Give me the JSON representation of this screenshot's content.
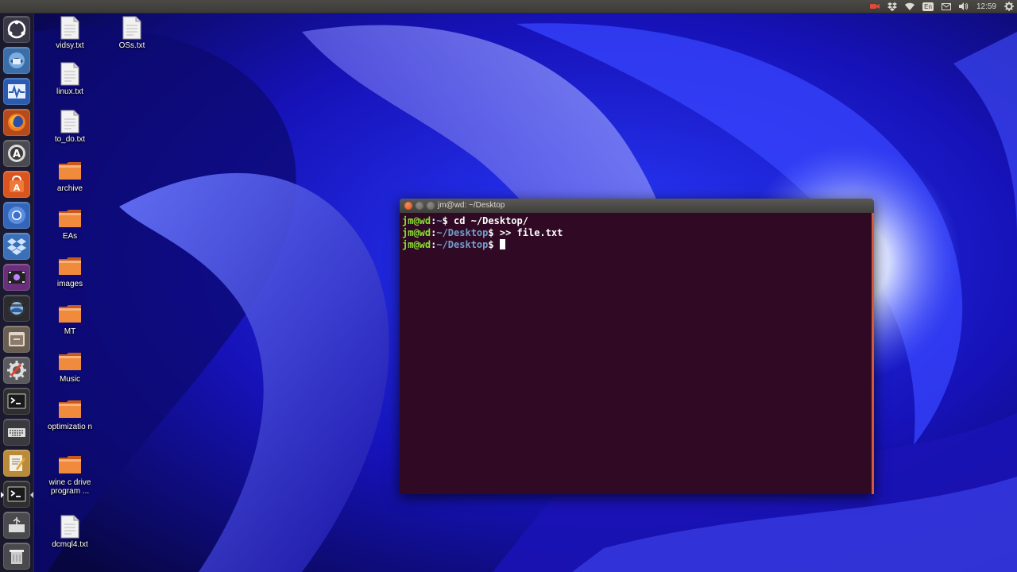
{
  "panel": {
    "clock": "12:59",
    "language": "En",
    "tray_icons": [
      "camera-icon",
      "dropbox-icon",
      "wifi-icon",
      "keyboard-layout-icon",
      "mail-icon",
      "volume-icon",
      "gear-icon"
    ]
  },
  "launcher": {
    "items": [
      {
        "name": "ubuntu-dash-icon"
      },
      {
        "name": "thunderbird-icon"
      },
      {
        "name": "system-monitor-icon"
      },
      {
        "name": "firefox-icon"
      },
      {
        "name": "software-updater-icon"
      },
      {
        "name": "ubuntu-software-center-icon"
      },
      {
        "name": "chromium-icon"
      },
      {
        "name": "dropbox-icon"
      },
      {
        "name": "video-editor-icon"
      },
      {
        "name": "photo-viewer-icon"
      },
      {
        "name": "files-icon"
      },
      {
        "name": "system-settings-icon"
      },
      {
        "name": "terminal-icon"
      },
      {
        "name": "keyboard-icon"
      },
      {
        "name": "text-editor-icon"
      },
      {
        "name": "terminal-active-icon"
      },
      {
        "name": "usb-drive-icon"
      },
      {
        "name": "trash-icon"
      }
    ]
  },
  "desktop": {
    "icons": [
      {
        "label": "vidsy.txt",
        "type": "text-file"
      },
      {
        "label": "OSs.txt",
        "type": "text-file"
      },
      {
        "label": "linux.txt",
        "type": "text-file"
      },
      {
        "label": "to_do.txt",
        "type": "text-file"
      },
      {
        "label": "archive",
        "type": "folder"
      },
      {
        "label": "EAs",
        "type": "folder"
      },
      {
        "label": "images",
        "type": "folder"
      },
      {
        "label": "MT",
        "type": "folder"
      },
      {
        "label": "Music",
        "type": "folder"
      },
      {
        "label": "optimizatio n",
        "type": "folder"
      },
      {
        "label": "wine c drive program ...",
        "type": "folder"
      },
      {
        "label": "dcmql4.txt",
        "type": "text-file"
      }
    ]
  },
  "terminal": {
    "title": "jm@wd: ~/Desktop",
    "lines": [
      {
        "user": "jm@wd",
        "sep": ":",
        "path": "~",
        "dollar": "$ ",
        "cmd": "cd ~/Desktop/"
      },
      {
        "user": "jm@wd",
        "sep": ":",
        "path": "~/Desktop",
        "dollar": "$ ",
        "cmd": ">> file.txt"
      },
      {
        "user": "jm@wd",
        "sep": ":",
        "path": "~/Desktop",
        "dollar": "$ ",
        "cmd": ""
      }
    ]
  },
  "colors": {
    "terminal_bg": "#300a24",
    "prompt_user": "#8ae234",
    "prompt_path": "#729fcf",
    "panel_bg": "#3c3b37",
    "folder": "#e9712a"
  }
}
